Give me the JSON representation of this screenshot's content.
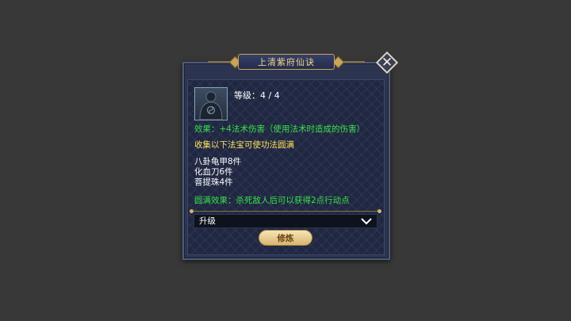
{
  "dialog": {
    "title": "上清紫府仙诀",
    "close_icon": "close-icon"
  },
  "skill": {
    "icon": "cultivator-silhouette-icon",
    "level_text": "等级：4 / 4",
    "effect_text": "效果：+4法术伤害（使用法术时造成的伤害）",
    "collect_text": "收集以下法宝可使功法圆满",
    "required_items": [
      "八卦龟甲8件",
      "化血刀6件",
      "菩提珠4件"
    ],
    "full_effect_text": "圆满效果：杀死敌人后可以获得2点行动点"
  },
  "upgrade_dropdown": {
    "selected": "升级",
    "icon": "chevron-down-icon"
  },
  "cultivate_button": {
    "label": "修炼"
  },
  "colors": {
    "effect_green": "#39e04a",
    "collect_yellow": "#ffe25a",
    "title_gold": "#f1d58a",
    "panel_bg": "#1f2742"
  }
}
